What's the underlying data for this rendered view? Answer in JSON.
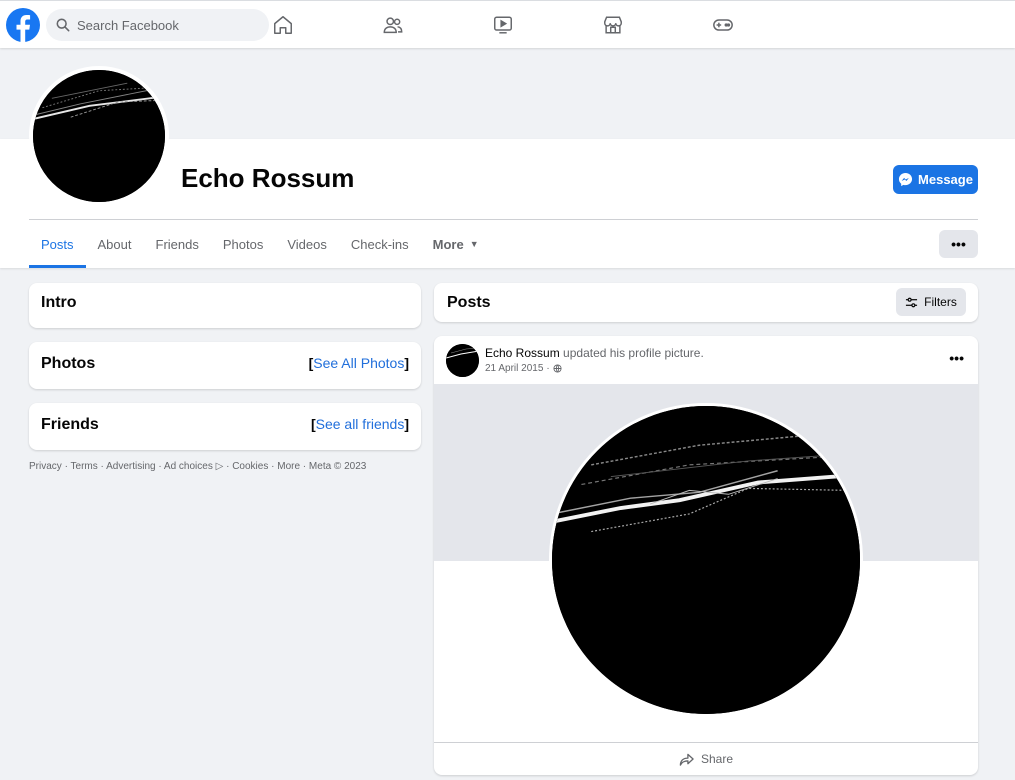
{
  "topnav": {
    "search_placeholder": "Search Facebook",
    "icons": [
      "facebook-logo",
      "home-icon",
      "friends-icon",
      "watch-icon",
      "marketplace-icon",
      "gaming-icon"
    ]
  },
  "profile": {
    "name": "Echo Rossum",
    "message_label": "Message"
  },
  "tabs": [
    {
      "label": "Posts",
      "active": true
    },
    {
      "label": "About"
    },
    {
      "label": "Friends"
    },
    {
      "label": "Photos"
    },
    {
      "label": "Videos"
    },
    {
      "label": "Check-ins"
    },
    {
      "label": "More"
    }
  ],
  "intro": {
    "title": "Intro"
  },
  "photos": {
    "title": "Photos",
    "link": "See All Photos"
  },
  "friends": {
    "title": "Friends",
    "link": "See all friends"
  },
  "footer": {
    "privacy": "Privacy",
    "terms": "Terms",
    "advertising": "Advertising",
    "ad_choices": "Ad choices",
    "cookies": "Cookies",
    "more": "More",
    "meta": "Meta © 2023"
  },
  "posts_header": {
    "title": "Posts",
    "filters_label": "Filters"
  },
  "post": {
    "author": "Echo Rossum",
    "action": "updated his profile picture.",
    "date": "21 April 2015",
    "privacy_icon": "globe-icon",
    "share_label": "Share"
  },
  "colors": {
    "accent": "#1b74e4",
    "background": "#f0f2f5"
  }
}
